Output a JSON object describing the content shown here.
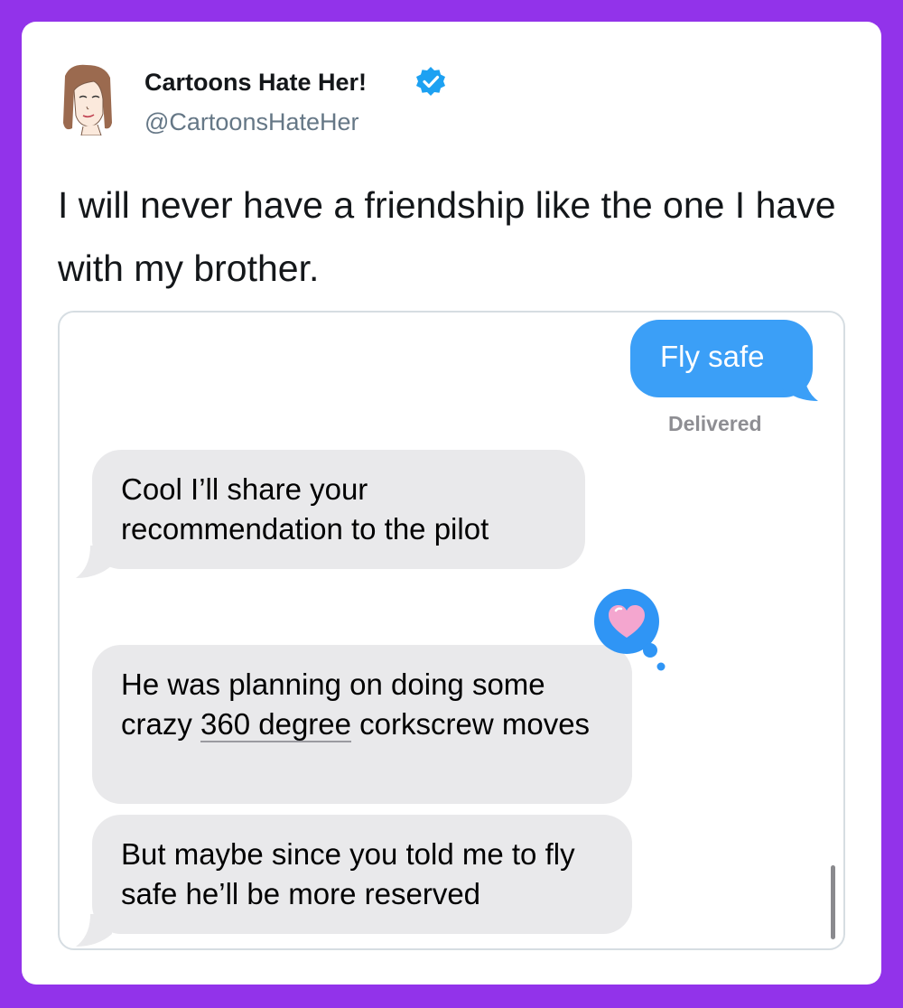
{
  "tweet": {
    "display_name": "Cartoons Hate Her!",
    "handle": "@CartoonsHateHer",
    "text": "I will never have a friendship like the one I have with my brother.",
    "verified_icon": "verified-badge-icon",
    "avatar_icon": "cartoon-portrait-avatar"
  },
  "messages": {
    "sent": "Fly safe",
    "status": "Delivered",
    "received_1": "Cool I’ll share your recommendation to the pilot",
    "received_2_pre": "He was planning on doing some crazy ",
    "received_2_link": "360 degree",
    "received_2_post": " corkscrew moves",
    "reaction_icon": "heart-reaction-icon",
    "received_3": "But maybe since you told me to fly safe he’ll be more reserved"
  },
  "colors": {
    "background": "#9233ea",
    "card": "#ffffff",
    "sent_bubble": "#3b9ff7",
    "received_bubble": "#e9e9eb",
    "verified": "#1da1f2",
    "heart": "#f4a6cf"
  }
}
